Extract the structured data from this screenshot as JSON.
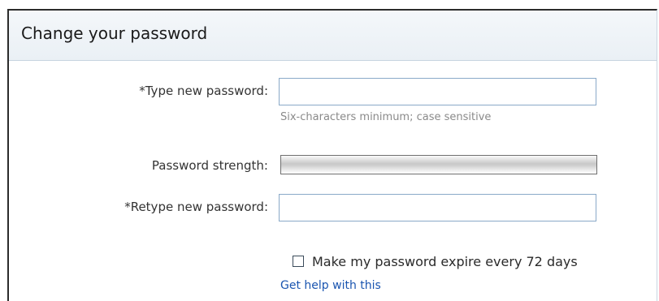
{
  "header": {
    "title": "Change your password"
  },
  "form": {
    "new_password": {
      "label": "*Type new password:",
      "value": "",
      "hint": "Six-characters minimum; case sensitive"
    },
    "strength": {
      "label": "Password strength:",
      "level_fraction": 0
    },
    "retype_password": {
      "label": "*Retype new password:",
      "value": ""
    },
    "expire_option": {
      "label": "Make my password expire every 72 days",
      "checked": false
    },
    "help_link": "Get help with this"
  },
  "colors": {
    "link": "#1a55b0",
    "input_border": "#8aa9c8",
    "hint_text": "#8a8a8a"
  }
}
